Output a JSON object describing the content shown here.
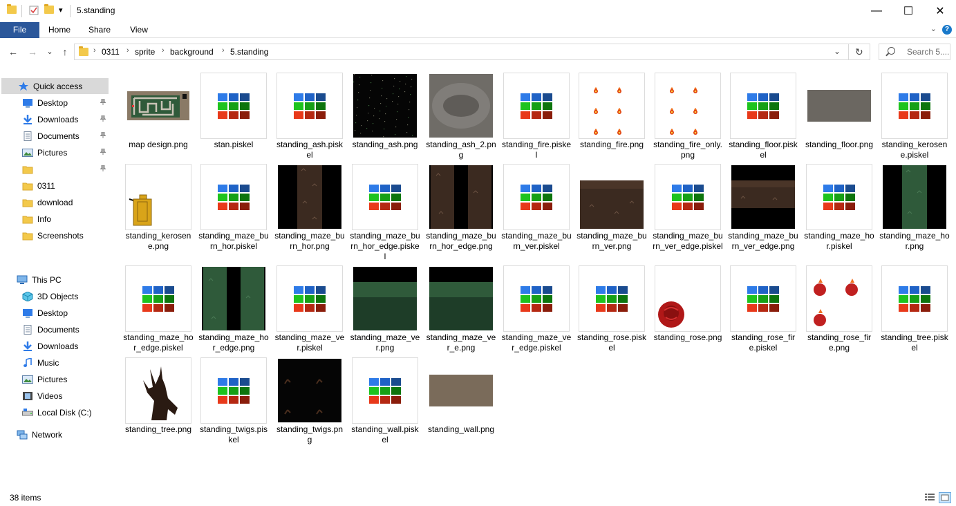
{
  "window": {
    "title": "5.standing",
    "minimize_glyph": "—",
    "maximize_glyph": "☐",
    "close_glyph": "✕",
    "quick_toolbar_dropdown": "▾"
  },
  "ribbon": {
    "tabs": [
      "File",
      "Home",
      "Share",
      "View"
    ],
    "expand_glyph": "⌄",
    "help_glyph": "?"
  },
  "nav": {
    "back_glyph": "←",
    "forward_glyph": "→",
    "recent_glyph": "⌄",
    "up_glyph": "↑",
    "breadcrumbs": [
      "0311",
      "sprite",
      "background",
      "5.standing"
    ],
    "crumb_sep": "›",
    "dropdown_glyph": "⌄",
    "refresh_glyph": "↻",
    "search_placeholder": "Search 5...."
  },
  "sidebar": {
    "quick_access": "Quick access",
    "quick_items": [
      {
        "label": "Desktop",
        "icon": "desktop-icon",
        "pinned": true
      },
      {
        "label": "Downloads",
        "icon": "downloads-icon",
        "pinned": true
      },
      {
        "label": "Documents",
        "icon": "documents-icon",
        "pinned": true
      },
      {
        "label": "Pictures",
        "icon": "pictures-icon",
        "pinned": true
      },
      {
        "label": "",
        "icon": "folder-icon",
        "pinned": true
      },
      {
        "label": "0311",
        "icon": "folder-icon",
        "pinned": false
      },
      {
        "label": "download",
        "icon": "folder-icon",
        "pinned": false
      },
      {
        "label": "Info",
        "icon": "folder-icon",
        "pinned": false
      },
      {
        "label": "Screenshots",
        "icon": "folder-icon",
        "pinned": false
      }
    ],
    "this_pc": "This PC",
    "pc_items": [
      {
        "label": "3D Objects",
        "icon": "3d-objects-icon"
      },
      {
        "label": "Desktop",
        "icon": "desktop-icon"
      },
      {
        "label": "Documents",
        "icon": "documents-icon"
      },
      {
        "label": "Downloads",
        "icon": "downloads-icon"
      },
      {
        "label": "Music",
        "icon": "music-icon"
      },
      {
        "label": "Pictures",
        "icon": "pictures-icon"
      },
      {
        "label": "Videos",
        "icon": "videos-icon"
      },
      {
        "label": "Local Disk (C:)",
        "icon": "local-disk-icon"
      }
    ],
    "network": "Network",
    "pin_glyph": "📌"
  },
  "files": [
    {
      "name": "map design.png",
      "kind": "maze"
    },
    {
      "name": "stan.piskel",
      "kind": "piskel"
    },
    {
      "name": "standing_ash.piskel",
      "kind": "piskel"
    },
    {
      "name": "standing_ash.png",
      "kind": "ash"
    },
    {
      "name": "standing_ash_2.png",
      "kind": "ash2"
    },
    {
      "name": "standing_fire.piskel",
      "kind": "piskel"
    },
    {
      "name": "standing_fire.png",
      "kind": "fire"
    },
    {
      "name": "standing_fire_only.png",
      "kind": "fire"
    },
    {
      "name": "standing_floor.piskel",
      "kind": "piskel"
    },
    {
      "name": "standing_floor.png",
      "kind": "floor"
    },
    {
      "name": "standing_kerosene.piskel",
      "kind": "piskel"
    },
    {
      "name": "standing_kerosene.png",
      "kind": "kerosene"
    },
    {
      "name": "standing_maze_burn_hor.piskel",
      "kind": "piskel"
    },
    {
      "name": "standing_maze_burn_hor.png",
      "kind": "burnhor"
    },
    {
      "name": "standing_maze_burn_hor_edge.piskel",
      "kind": "piskel"
    },
    {
      "name": "standing_maze_burn_hor_edge.png",
      "kind": "burnhoredge"
    },
    {
      "name": "standing_maze_burn_ver.piskel",
      "kind": "piskel"
    },
    {
      "name": "standing_maze_burn_ver.png",
      "kind": "burnver"
    },
    {
      "name": "standing_maze_burn_ver_edge.piskel",
      "kind": "piskel"
    },
    {
      "name": "standing_maze_burn_ver_edge.png",
      "kind": "burnveredge"
    },
    {
      "name": "standing_maze_hor.piskel",
      "kind": "piskel"
    },
    {
      "name": "standing_maze_hor.png",
      "kind": "mazehor"
    },
    {
      "name": "standing_maze_hor_edge.piskel",
      "kind": "piskel"
    },
    {
      "name": "standing_maze_hor_edge.png",
      "kind": "mazehoredge"
    },
    {
      "name": "standing_maze_ver.piskel",
      "kind": "piskel"
    },
    {
      "name": "standing_maze_ver.png",
      "kind": "mazever"
    },
    {
      "name": "standing_maze_ver_e.png",
      "kind": "mazever"
    },
    {
      "name": "standing_maze_ver_edge.piskel",
      "kind": "piskel"
    },
    {
      "name": "standing_rose.piskel",
      "kind": "piskel"
    },
    {
      "name": "standing_rose.png",
      "kind": "rose"
    },
    {
      "name": "standing_rose_fire.piskel",
      "kind": "piskel"
    },
    {
      "name": "standing_rose_fire.png",
      "kind": "rosefire"
    },
    {
      "name": "standing_tree.piskel",
      "kind": "piskel"
    },
    {
      "name": "standing_tree.png",
      "kind": "tree"
    },
    {
      "name": "standing_twigs.piskel",
      "kind": "piskel"
    },
    {
      "name": "standing_twigs.png",
      "kind": "twigs"
    },
    {
      "name": "standing_wall.piskel",
      "kind": "piskel"
    },
    {
      "name": "standing_wall.png",
      "kind": "wall"
    }
  ],
  "status": {
    "item_count": "38 items"
  },
  "colors": {
    "selected_bg": "#d9d9d9",
    "file_tab": "#2b579a",
    "folder": "#f3c94b",
    "piskel": [
      "#2e7be8",
      "#1f62c6",
      "#1a4b8f",
      "#1ec31e",
      "#16a016",
      "#0d750d",
      "#e8391a",
      "#b52812",
      "#8a1d0b"
    ]
  }
}
